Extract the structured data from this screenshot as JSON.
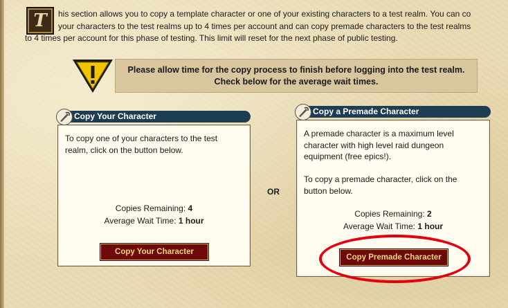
{
  "intro": {
    "drop_cap": "T",
    "line1": "his section allows you to copy a template character or one of your existing characters to a test realm. You can co",
    "line2": "your characters to the test realms up to 4 times per account and can copy premade characters to the test realms",
    "line3": "to 4 times per account for this phase of testing. This limit will reset for the next phase of public testing."
  },
  "notice": {
    "icon": "warning-icon",
    "line1": "Please allow time for the copy process to finish before logging into the test realm.",
    "line2": "Check below for the average wait times."
  },
  "separator": "OR",
  "copy_your_character": {
    "title": "Copy Your Character",
    "icon": "quill-icon",
    "description_line1": "To copy one of your characters to the test",
    "description_line2": "realm, click on the button below.",
    "copies_label": "Copies Remaining:",
    "copies_value": "4",
    "wait_label": "Average Wait Time:",
    "wait_value": "1 hour",
    "button_label": "Copy Your Character"
  },
  "copy_premade_character": {
    "title": "Copy a Premade Character",
    "icon": "quill-icon",
    "description_line1": "A premade character is a maximum level",
    "description_line2": "character with high level raid dungeon",
    "description_line3": "equipment (free epics!).",
    "description_line4": "To copy a premade character, click on the",
    "description_line5": "button below.",
    "copies_label": "Copies Remaining:",
    "copies_value": "2",
    "wait_label": "Average Wait Time:",
    "wait_value": "1 hour",
    "button_label": "Copy Premade Character"
  },
  "colors": {
    "header_bg": "#1d3d52",
    "button_bg": "#6e0a0a",
    "button_text": "#f2d47a",
    "highlight_circle": "#e3000f",
    "parchment": "#e9dbb4"
  }
}
